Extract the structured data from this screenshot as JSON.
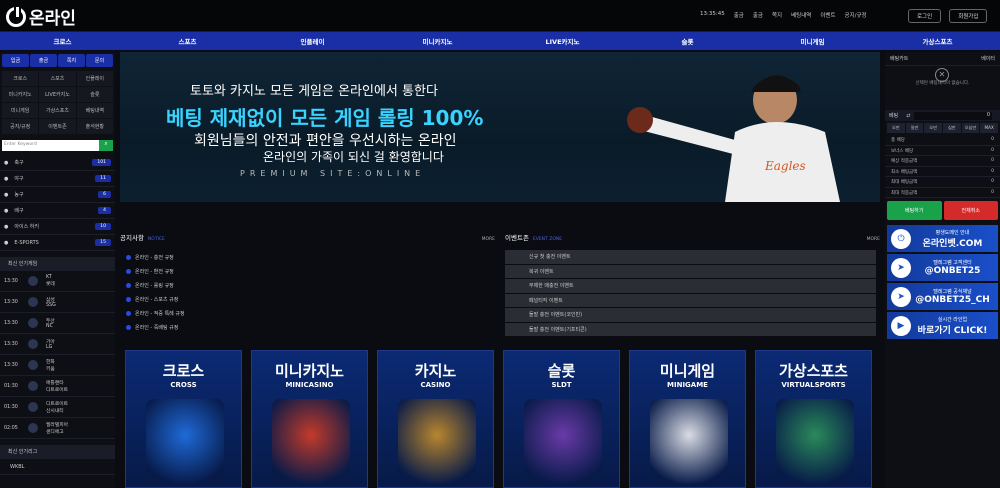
{
  "header": {
    "logo": "온라인",
    "clock": "13:35:45",
    "utils": [
      "출금",
      "출금",
      "쪽지",
      "베팅내역",
      "이벤트",
      "공지/규정"
    ],
    "login": "로그인",
    "join": "회원가입"
  },
  "nav": [
    "크로스",
    "스포츠",
    "인플레이",
    "미니카지노",
    "LIVE카지노",
    "슬롯",
    "미니게임",
    "가상스포츠"
  ],
  "left": {
    "tabs": [
      "입금",
      "출금",
      "쪽지",
      "문의"
    ],
    "grid": [
      "크로스",
      "스포츠",
      "인플레이",
      "미니카지노",
      "LIVE카지노",
      "슬롯",
      "미니게임",
      "가상스포츠",
      "베팅내역",
      "공지/규정",
      "이벤트존",
      "출석현황"
    ],
    "search_placeholder": "Enter Keyword",
    "sports": [
      {
        "name": "축구",
        "count": "101"
      },
      {
        "name": "야구",
        "count": "11"
      },
      {
        "name": "농구",
        "count": "6"
      },
      {
        "name": "배구",
        "count": "4"
      },
      {
        "name": "아이스 하키",
        "count": "10"
      },
      {
        "name": "E-SPORTS",
        "count": "15"
      }
    ],
    "recent_title": "최신 인기게임",
    "games": [
      {
        "time": "13:30",
        "teams": "KT\n롯데"
      },
      {
        "time": "13:30",
        "teams": "삼성\nSSG"
      },
      {
        "time": "13:30",
        "teams": "두산\nNC"
      },
      {
        "time": "13:30",
        "teams": "기아\nLG"
      },
      {
        "time": "13:30",
        "teams": "한화\n키움"
      },
      {
        "time": "01:30",
        "teams": "애틀랜타\n디트로이트"
      },
      {
        "time": "01:30",
        "teams": "디트로이트\n신시내티"
      },
      {
        "time": "02:05",
        "teams": "필라델피아\n샌디에고"
      }
    ],
    "popular_title": "최신 인기리그",
    "league": "WKBL"
  },
  "banner": {
    "line1": "토토와 카지노 모든 게임은 온라인에서 통한다",
    "line2": "베팅 제재없이 모든 게임 롤링 100%",
    "line3": "회원님들의 안전과 편안을 우선시하는 온라인",
    "line4": "온라인의 가족이 되신 걸 환영합니다",
    "line5": "PREMIUM SITE:ONLINE"
  },
  "notice": {
    "title": "공지사항",
    "sub": "NOTICE",
    "more": "MORE",
    "items": [
      "온라인 - 충전 규정",
      "온라인 - 환전 규정",
      "온라인 - 롤링 규정",
      "온라인 - 스포츠 규정",
      "온라인 - 적중 특례 규정",
      "온라인 - 죽배팅 규정"
    ]
  },
  "events": {
    "title": "이벤트존",
    "sub": "EVENT ZONE",
    "more": "MORE",
    "items": [
      "신규 첫 충전 이벤트",
      "복귀 이벤트",
      "무제한 매충전 이벤트",
      "페널티킥 이벤트",
      "돌발 충전 이벤트(코인빈)",
      "돌발 충전 이벤트(기프티콘)"
    ]
  },
  "cards": [
    {
      "ko": "크로스",
      "en": "CROSS",
      "c": "#1f6ad8"
    },
    {
      "ko": "미니카지노",
      "en": "MINICASINO",
      "c": "#c43a2a"
    },
    {
      "ko": "카지노",
      "en": "CASINO",
      "c": "#b8862e"
    },
    {
      "ko": "슬롯",
      "en": "SLDT",
      "c": "#6a3aa8"
    },
    {
      "ko": "미니게임",
      "en": "MINIGAME",
      "c": "#d9dce4"
    },
    {
      "ko": "가상스포츠",
      "en": "VIRTUALSPORTS",
      "c": "#2a8a5a"
    }
  ],
  "right": {
    "tab1": "베팅카트",
    "tab2": "베이터",
    "empty": "선택된 베팅내역이 없습니다.",
    "bet_label": "베팅",
    "bet_value": "0",
    "amounts": [
      "오만",
      "일만",
      "오만",
      "십만",
      "오십만",
      "MAX"
    ],
    "stats": [
      {
        "l": "총 배당",
        "v": "0"
      },
      {
        "l": "보너스 배당",
        "v": "0"
      },
      {
        "l": "예상 적중금액",
        "v": "0"
      },
      {
        "l": "최소 배팅금액",
        "v": "0"
      },
      {
        "l": "최대 배팅금액",
        "v": "0"
      },
      {
        "l": "최대 적중금액",
        "v": "0"
      }
    ],
    "bet_btn": "베팅하기",
    "clear_btn": "전체취소",
    "promos": [
      {
        "a": "평생도메인 안내",
        "b": "온라인벳.COM"
      },
      {
        "a": "텔레그램 고객센터",
        "b": "@ONBET25"
      },
      {
        "a": "텔레그램 공식채널",
        "b": "@ONBET25_CH"
      },
      {
        "a": "실시간 라인업",
        "b": "바로가기 CLICK!"
      }
    ]
  }
}
